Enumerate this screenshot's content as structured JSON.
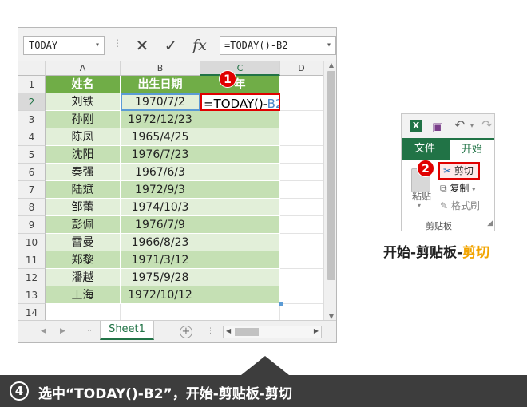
{
  "formula_bar": {
    "namebox": "TODAY",
    "formula": "=TODAY()-B2",
    "fx": "fx"
  },
  "columns": [
    "A",
    "B",
    "C",
    "D"
  ],
  "rows": [
    [
      "姓名",
      "出生日期",
      "年"
    ],
    [
      "刘铁",
      "1970/7/2",
      ""
    ],
    [
      "孙刚",
      "1972/12/23",
      ""
    ],
    [
      "陈凤",
      "1965/4/25",
      ""
    ],
    [
      "沈阳",
      "1976/7/23",
      ""
    ],
    [
      "秦强",
      "1967/6/3",
      ""
    ],
    [
      "陆斌",
      "1972/9/3",
      ""
    ],
    [
      "邹蕾",
      "1974/10/3",
      ""
    ],
    [
      "彭佩",
      "1976/7/9",
      ""
    ],
    [
      "雷曼",
      "1966/8/23",
      ""
    ],
    [
      "郑黎",
      "1971/3/12",
      ""
    ],
    [
      "潘越",
      "1975/9/28",
      ""
    ],
    [
      "王海",
      "1972/10/12",
      ""
    ],
    [
      "",
      "",
      ""
    ]
  ],
  "row_numbers": [
    "1",
    "2",
    "3",
    "4",
    "5",
    "6",
    "7",
    "8",
    "9",
    "10",
    "11",
    "12",
    "13",
    "14"
  ],
  "editing_cell": {
    "prefix": "=",
    "func": "TODAY()-",
    "ref": "B2"
  },
  "sheet_tab": "Sheet1",
  "badges": [
    "1",
    "2"
  ],
  "ribbon": {
    "tab_file": "文件",
    "tab_home": "开始",
    "cut": "剪切",
    "copy": "复制",
    "format_painter": "格式刷",
    "paste": "粘贴",
    "group_label": "剪贴板"
  },
  "caption": {
    "part1": "开始-剪贴板-",
    "part2": "剪切"
  },
  "banner": {
    "step": "4",
    "text": "选中“TODAY()-B2”，开始-剪贴板-剪切"
  },
  "colors": {
    "excel_green": "#217346",
    "header_fill": "#70ad47",
    "band_light": "#e2efd9",
    "band_dark": "#c5e0b4",
    "highlight_red": "#e00000",
    "banner_bg": "#3d3d3d"
  }
}
